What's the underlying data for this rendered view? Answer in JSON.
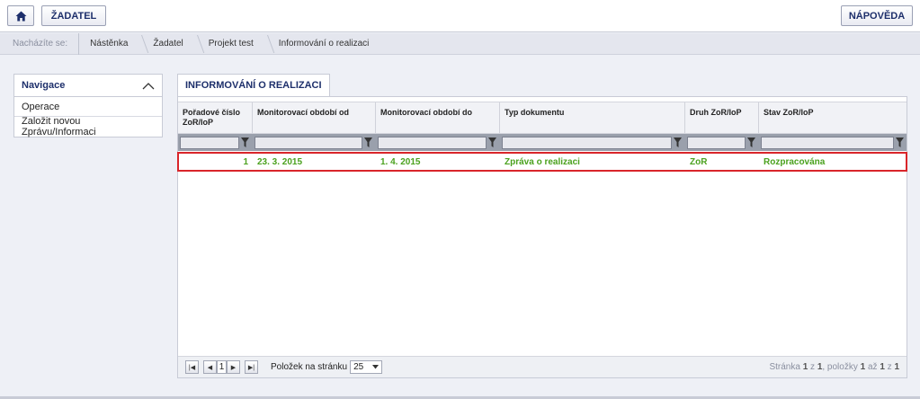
{
  "header": {
    "home_icon": "home-icon",
    "zadatel_label": "ŽADATEL",
    "help_label": "NÁPOVĚDA"
  },
  "breadcrumb": {
    "label": "Nacházíte se:",
    "items": [
      "Nástěnka",
      "Žadatel",
      "Projekt test",
      "Informování o realizaci"
    ]
  },
  "navigation": {
    "title": "Navigace",
    "collapse_icon": "chevron-up-icon",
    "items": [
      "Operace",
      "Založit novou Zprávu/Informaci"
    ]
  },
  "main": {
    "tab_label": "INFORMOVÁNÍ O REALIZACI",
    "columns": [
      "Pořadové číslo ZoR/IoP",
      "Monitorovací období od",
      "Monitorovací období do",
      "Typ dokumentu",
      "Druh ZoR/IoP",
      "Stav ZoR/IoP"
    ],
    "rows": [
      [
        "1",
        "23. 3. 2015",
        "1. 4. 2015",
        "Zpráva o realizaci",
        "ZoR",
        "Rozpracována"
      ]
    ],
    "filter_icon": "filter-icon"
  },
  "pager": {
    "current_page": "1",
    "per_page_label": "Položek na stránku",
    "per_page_value": "25",
    "info_prefix": "Stránka ",
    "info_page": "1",
    "info_of": " z ",
    "info_pages": "1",
    "info_items": ", položky ",
    "info_from": "1",
    "info_to_word": " až ",
    "info_to": "1",
    "info_z2": " z ",
    "info_total": "1"
  },
  "colors": {
    "accent": "#1d2f6b",
    "row_text": "#4aa11d",
    "highlight_border": "#d9252a"
  }
}
